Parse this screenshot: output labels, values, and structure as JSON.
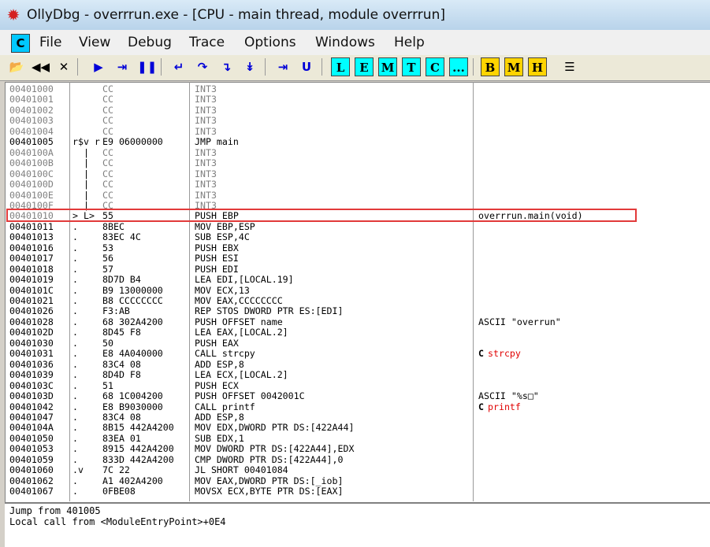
{
  "window": {
    "title": "OllyDbg - overrrun.exe - [CPU - main thread, module overrrun]",
    "icon": "bug-icon"
  },
  "menu": {
    "mdi_label": "C",
    "items": [
      "File",
      "View",
      "Debug",
      "Trace",
      "Options",
      "Windows",
      "Help"
    ]
  },
  "toolbar": {
    "controls": [
      "open-icon",
      "rewind-icon",
      "close-icon"
    ],
    "run_controls": [
      "run-icon",
      "step-forward-icon",
      "pause-icon"
    ],
    "step_controls": [
      "step-into-icon",
      "step-over-icon",
      "trace-into-icon",
      "trace-over-icon"
    ],
    "exec_controls": [
      "execute-till-return-icon",
      "execute-till-user-code-icon"
    ],
    "windows": [
      "L",
      "E",
      "M",
      "T",
      "C",
      "..."
    ],
    "bp_windows": [
      "B",
      "M",
      "H"
    ],
    "list_icon": "list-icon"
  },
  "colors": {
    "window_buttons": "#00ffff",
    "bp_buttons": "#ffd400",
    "highlight_box": "#e23a3a",
    "comment_red": "#e00000"
  },
  "disasm": {
    "rows": [
      {
        "addr": "00401000",
        "gutter": "",
        "hex": "CC",
        "asm": "INT3",
        "comment": "",
        "dim": true
      },
      {
        "addr": "00401001",
        "gutter": "",
        "hex": "CC",
        "asm": "INT3",
        "comment": "",
        "dim": true
      },
      {
        "addr": "00401002",
        "gutter": "",
        "hex": "CC",
        "asm": "INT3",
        "comment": "",
        "dim": true
      },
      {
        "addr": "00401003",
        "gutter": "",
        "hex": "CC",
        "asm": "INT3",
        "comment": "",
        "dim": true
      },
      {
        "addr": "00401004",
        "gutter": "",
        "hex": "CC",
        "asm": "INT3",
        "comment": "",
        "dim": true
      },
      {
        "addr": "00401005",
        "gutter": "r$v r",
        "hex": "E9 06000000",
        "asm": "JMP main",
        "comment": "",
        "dim": false
      },
      {
        "addr": "0040100A",
        "gutter": "  |",
        "hex": "CC",
        "asm": "INT3",
        "comment": "",
        "dim": true
      },
      {
        "addr": "0040100B",
        "gutter": "  |",
        "hex": "CC",
        "asm": "INT3",
        "comment": "",
        "dim": true
      },
      {
        "addr": "0040100C",
        "gutter": "  |",
        "hex": "CC",
        "asm": "INT3",
        "comment": "",
        "dim": true
      },
      {
        "addr": "0040100D",
        "gutter": "  |",
        "hex": "CC",
        "asm": "INT3",
        "comment": "",
        "dim": true
      },
      {
        "addr": "0040100E",
        "gutter": "  |",
        "hex": "CC",
        "asm": "INT3",
        "comment": "",
        "dim": true
      },
      {
        "addr": "0040100F",
        "gutter": "  |",
        "hex": "CC",
        "asm": "INT3",
        "comment": "",
        "dim": true
      },
      {
        "addr": "00401010",
        "gutter": "> L>",
        "hex": "55",
        "asm": "PUSH EBP",
        "comment": "overrrun.main(void)",
        "dim": false
      },
      {
        "addr": "00401011",
        "gutter": ".",
        "hex": "8BEC",
        "asm": "MOV EBP,ESP",
        "comment": "",
        "dim": false
      },
      {
        "addr": "00401013",
        "gutter": ".",
        "hex": "83EC 4C",
        "asm": "SUB ESP,4C",
        "comment": "",
        "dim": false
      },
      {
        "addr": "00401016",
        "gutter": ".",
        "hex": "53",
        "asm": "PUSH EBX",
        "comment": "",
        "dim": false
      },
      {
        "addr": "00401017",
        "gutter": ".",
        "hex": "56",
        "asm": "PUSH ESI",
        "comment": "",
        "dim": false
      },
      {
        "addr": "00401018",
        "gutter": ".",
        "hex": "57",
        "asm": "PUSH EDI",
        "comment": "",
        "dim": false
      },
      {
        "addr": "00401019",
        "gutter": ".",
        "hex": "8D7D B4",
        "asm": "LEA EDI,[LOCAL.19]",
        "comment": "",
        "dim": false
      },
      {
        "addr": "0040101C",
        "gutter": ".",
        "hex": "B9 13000000",
        "asm": "MOV ECX,13",
        "comment": "",
        "dim": false
      },
      {
        "addr": "00401021",
        "gutter": ".",
        "hex": "B8 CCCCCCCC",
        "asm": "MOV EAX,CCCCCCCC",
        "comment": "",
        "dim": false
      },
      {
        "addr": "00401026",
        "gutter": ".",
        "hex": "F3:AB",
        "asm": "REP STOS DWORD PTR ES:[EDI]",
        "comment": "",
        "dim": false
      },
      {
        "addr": "00401028",
        "gutter": ".",
        "hex": "68 302A4200",
        "asm": "PUSH OFFSET name",
        "comment": "ASCII \"overrun\"",
        "dim": false
      },
      {
        "addr": "0040102D",
        "gutter": ".",
        "hex": "8D45 F8",
        "asm": "LEA EAX,[LOCAL.2]",
        "comment": "",
        "dim": false
      },
      {
        "addr": "00401030",
        "gutter": ".",
        "hex": "50",
        "asm": "PUSH EAX",
        "comment": "",
        "dim": false
      },
      {
        "addr": "00401031",
        "gutter": ".",
        "hex": "E8 4A040000",
        "asm": "CALL strcpy",
        "comment": "strcpy",
        "dim": false
      },
      {
        "addr": "00401036",
        "gutter": ".",
        "hex": "83C4 08",
        "asm": "ADD ESP,8",
        "comment": "",
        "dim": false
      },
      {
        "addr": "00401039",
        "gutter": ".",
        "hex": "8D4D F8",
        "asm": "LEA ECX,[LOCAL.2]",
        "comment": "",
        "dim": false
      },
      {
        "addr": "0040103C",
        "gutter": ".",
        "hex": "51",
        "asm": "PUSH ECX",
        "comment": "",
        "dim": false
      },
      {
        "addr": "0040103D",
        "gutter": ".",
        "hex": "68 1C004200",
        "asm": "PUSH OFFSET 0042001C",
        "comment": "ASCII \"%s□\"",
        "dim": false
      },
      {
        "addr": "00401042",
        "gutter": ".",
        "hex": "E8 B9030000",
        "asm": "CALL printf",
        "comment": "printf",
        "dim": false
      },
      {
        "addr": "00401047",
        "gutter": ".",
        "hex": "83C4 08",
        "asm": "ADD ESP,8",
        "comment": "",
        "dim": false
      },
      {
        "addr": "0040104A",
        "gutter": ".",
        "hex": "8B15 442A4200",
        "asm": "MOV EDX,DWORD PTR DS:[422A44]",
        "comment": "",
        "dim": false
      },
      {
        "addr": "00401050",
        "gutter": ".",
        "hex": "83EA 01",
        "asm": "SUB EDX,1",
        "comment": "",
        "dim": false
      },
      {
        "addr": "00401053",
        "gutter": ".",
        "hex": "8915 442A4200",
        "asm": "MOV DWORD PTR DS:[422A44],EDX",
        "comment": "",
        "dim": false
      },
      {
        "addr": "00401059",
        "gutter": ".",
        "hex": "833D 442A4200",
        "asm": "CMP DWORD PTR DS:[422A44],0",
        "comment": "",
        "dim": false
      },
      {
        "addr": "00401060",
        "gutter": ".v",
        "hex": "7C 22",
        "asm": "JL SHORT 00401084",
        "comment": "",
        "dim": false
      },
      {
        "addr": "00401062",
        "gutter": ".",
        "hex": "A1 402A4200",
        "asm": "MOV EAX,DWORD PTR DS:[_iob]",
        "comment": "",
        "dim": false
      },
      {
        "addr": "00401067",
        "gutter": ".",
        "hex": "0FBE08",
        "asm": "MOVSX ECX,BYTE PTR DS:[EAX]",
        "comment": "",
        "dim": false
      }
    ]
  },
  "info": {
    "line1": "Jump from 401005",
    "line2": "Local call from <ModuleEntryPoint>+0E4"
  }
}
